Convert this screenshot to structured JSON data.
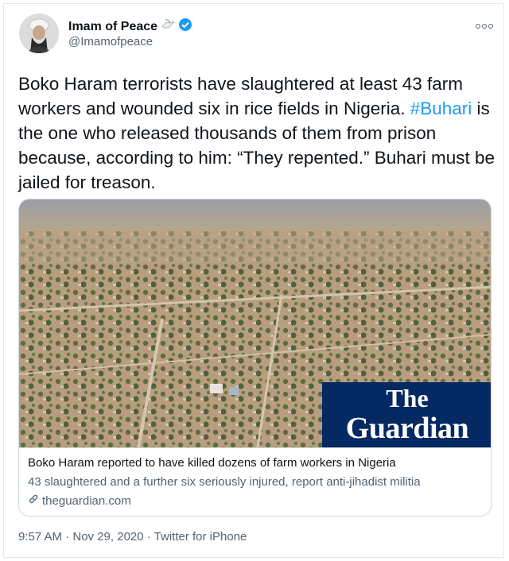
{
  "user": {
    "display_name": "Imam of Peace",
    "handle": "@Imamofpeace",
    "verified": true,
    "emoji_icon": "dove-icon"
  },
  "tweet": {
    "text_part1": "Boko Haram terrorists have slaughtered at least 43 farm workers and wounded six in rice fields in Nigeria. ",
    "hashtag": "#Buhari",
    "text_part2": " is the one who released thousands of them from prison because, according to him: “They repented.” Buhari must be jailed for treason."
  },
  "card": {
    "logo_line1": "The",
    "logo_line2": "Guardian",
    "title": "Boko Haram reported to have killed dozens of farm workers in Nigeria",
    "description": "43 slaughtered and a further six seriously injured, report anti-jihadist militia",
    "domain": "theguardian.com"
  },
  "meta": {
    "timestamp": "9:57 AM · Nov 29, 2020 · Twitter for iPhone"
  },
  "colors": {
    "link": "#1d9bf0",
    "guardian_blue": "#052962",
    "verified_blue": "#1d9bf0"
  }
}
